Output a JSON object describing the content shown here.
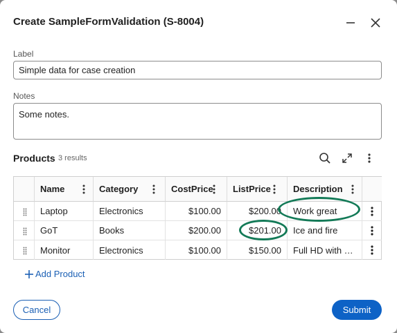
{
  "dialog": {
    "title": "Create SampleFormValidation (S-8004)",
    "minimize_icon": "minimize-icon",
    "close_icon": "close-icon"
  },
  "form": {
    "label_caption": "Label",
    "label_value": "Simple data for case creation",
    "notes_caption": "Notes",
    "notes_value": "Some notes."
  },
  "products": {
    "title": "Products",
    "count": "3 results",
    "columns": [
      "Name",
      "Category",
      "CostPrice",
      "ListPrice",
      "Description"
    ],
    "rows": [
      {
        "name": "Laptop",
        "category": "Electronics",
        "cost": "$100.00",
        "list": "$200.00",
        "description": "Work great"
      },
      {
        "name": "GoT",
        "category": "Books",
        "cost": "$200.00",
        "list": "$201.00",
        "description": "Ice and fire"
      },
      {
        "name": "Monitor",
        "category": "Electronics",
        "cost": "$100.00",
        "list": "$150.00",
        "description": "Full HD with …"
      }
    ],
    "add_label": "Add Product"
  },
  "actions": {
    "cancel_label": "Cancel",
    "submit_label": "Submit"
  },
  "colors": {
    "primary": "#0d62c6",
    "annotation": "#137a57"
  }
}
